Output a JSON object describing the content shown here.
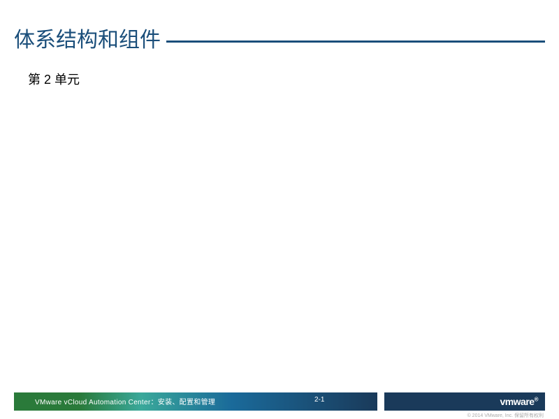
{
  "slide": {
    "title": "体系结构和组件",
    "subtitle": "第 2 单元"
  },
  "footer": {
    "course": "VMware vCloud   Automation Center：安装、配置和管理",
    "page": "2-1",
    "logo": "vmware",
    "copyright": "© 2014 VMware, Inc. 保留所有权利"
  },
  "colors": {
    "accent": "#1a4e7a",
    "footer_dark": "#1a3a5a"
  }
}
